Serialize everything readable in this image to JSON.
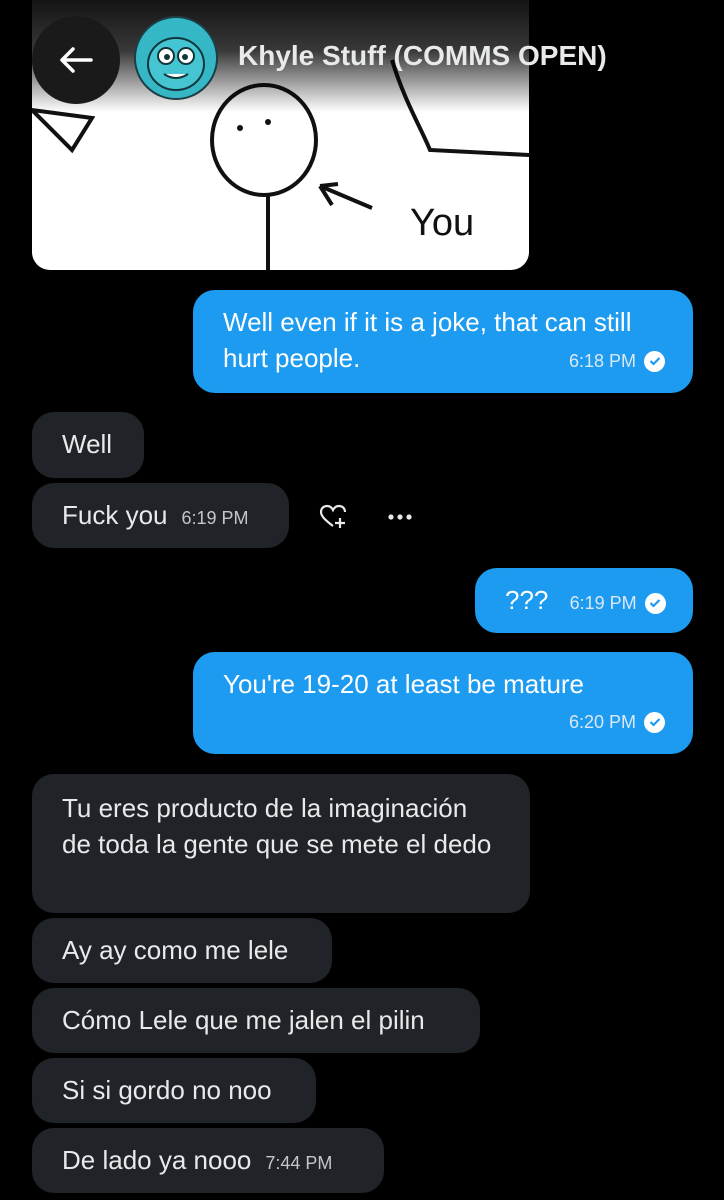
{
  "header": {
    "title": "Khyle Stuff (COMMS OPEN)",
    "back_icon": "arrow-left-icon",
    "avatar_icon": "avatar-cartoon-icon"
  },
  "shared_image": {
    "caption_text": "You"
  },
  "messages": [
    {
      "dir": "out",
      "text": "Well even if it is a joke, that can still hurt people.",
      "time": "6:18 PM"
    },
    {
      "dir": "in",
      "text": "Well"
    },
    {
      "dir": "in",
      "text": "Fuck you",
      "time": "6:19 PM"
    },
    {
      "dir": "out",
      "text": "???",
      "time": "6:19 PM"
    },
    {
      "dir": "out",
      "text": "You're 19-20 at least be mature",
      "time": "6:20 PM"
    },
    {
      "dir": "in",
      "text": "Tu eres producto de la imaginación de toda la gente que se mete el dedo"
    },
    {
      "dir": "in",
      "text": "Ay ay como me lele"
    },
    {
      "dir": "in",
      "text": "Cómo Lele que me jalen el pilin"
    },
    {
      "dir": "in",
      "text": "Si si gordo no noo"
    },
    {
      "dir": "in",
      "text": "De lado ya nooo",
      "time": "7:44 PM"
    }
  ],
  "actions": {
    "react_icon": "heart-plus-icon",
    "more_icon": "more-dots-icon"
  },
  "colors": {
    "background": "#000000",
    "outgoing_bubble": "#1d9bf0",
    "incoming_bubble": "#202327"
  }
}
